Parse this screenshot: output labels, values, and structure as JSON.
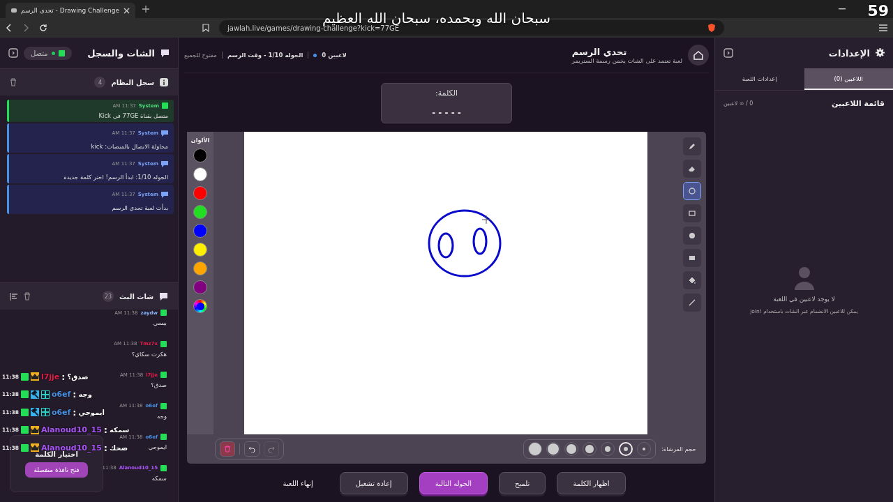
{
  "browser": {
    "tab_title": "تحدي الرسم - Drawing Challenge",
    "url": "jawlah.live/games/drawing-challenge?kick=77GE"
  },
  "overlay": {
    "caption": "سبحان الله وبحمده، سبحان الله العظيم",
    "counter": "59",
    "lines": [
      {
        "time": "11:38",
        "badges": [
          {
            "kind": "crown"
          }
        ],
        "user": "l7jje",
        "color": "#e11d48",
        "sep": ":",
        "text": "صدق؟"
      },
      {
        "time": "11:38",
        "badges": [
          {
            "kind": "hammer"
          },
          {
            "kind": "bot"
          }
        ],
        "user": "o6ef",
        "color": "#4a90e2",
        "sep": ":",
        "text": "وجه"
      },
      {
        "time": "11:38",
        "badges": [
          {
            "kind": "hammer"
          },
          {
            "kind": "bot"
          }
        ],
        "user": "o6ef",
        "color": "#4a90e2",
        "sep": ":",
        "text": "ايموجي"
      },
      {
        "time": "11:38",
        "badges": [
          {
            "kind": "crown"
          }
        ],
        "user": "Alanoud10_15",
        "color": "#a855f7",
        "sep": ":",
        "text": "سمكه"
      },
      {
        "time": "11:38",
        "badges": [
          {
            "kind": "crown"
          }
        ],
        "user": "Alanoud10_15",
        "color": "#a855f7",
        "sep": ":",
        "text": "ضحك"
      }
    ]
  },
  "chat_panel": {
    "title": "الشات والسجل",
    "status": "متصل",
    "connected": true,
    "system_log": {
      "title": "سجل النظام",
      "count": "4",
      "messages": [
        {
          "kind": "kick",
          "author": "System",
          "time": "11:37 AM",
          "text": "متصل بقناة 77GE في Kick"
        },
        {
          "kind": "system",
          "author": "System",
          "time": "11:37 AM",
          "text": "محاولة الاتصال بالمنصات: kick"
        },
        {
          "kind": "system",
          "author": "System",
          "time": "11:37 AM",
          "text": "الجوله 1/10: ابدأ الرسم! اختر كلمة جديدة"
        },
        {
          "kind": "system",
          "author": "System",
          "time": "11:37 AM",
          "text": "بدأت لعبة تحدي الرسم"
        }
      ]
    },
    "stream_chat": {
      "title": "شات البث",
      "count": "23",
      "messages": [
        {
          "author": "zaydw",
          "color": "#8ab4f8",
          "time": "11:38 AM",
          "text": "ببسي"
        },
        {
          "author": "Tmz7x",
          "color": "#e11d48",
          "time": "11:38 AM",
          "text": "هكرت سكاي؟"
        },
        {
          "author": "l7jje",
          "color": "#e11d48",
          "time": "11:38 AM",
          "text": "صدق؟"
        },
        {
          "author": "o6ef",
          "color": "#4a90e2",
          "time": "11:38 AM",
          "text": "وجه"
        },
        {
          "author": "o6ef",
          "color": "#4a90e2",
          "time": "11:38 AM",
          "text": "ايموجي"
        },
        {
          "author": "Alanoud10_15",
          "color": "#a855f7",
          "time": "11:38",
          "text": "سمكه"
        }
      ]
    },
    "word_picker": {
      "title": "اختيار الكلمة",
      "button": "فتح نافذة منفصلة"
    }
  },
  "game": {
    "title": "تحدي الرسم",
    "subtitle": "لعبة تعتمد على الشات يخمن رسمة الستريمر",
    "players": "0 لاعبين",
    "round": "الجوله 1/10 - وقت الرسم",
    "mode": "مفتوح للجميع",
    "word": {
      "label": "الكلمة:",
      "hint": "- - - - -"
    },
    "colors": {
      "title": "الألوان",
      "swatches": [
        {
          "kind": "solid",
          "color": "#000000"
        },
        {
          "kind": "solid",
          "color": "#ffffff"
        },
        {
          "kind": "solid",
          "color": "#ff0000"
        },
        {
          "kind": "solid",
          "color": "#22dd22"
        },
        {
          "kind": "solid",
          "color": "#0000ff"
        },
        {
          "kind": "solid",
          "color": "#ffee00"
        },
        {
          "kind": "solid",
          "color": "#ffa500"
        },
        {
          "kind": "solid",
          "color": "#800080"
        },
        {
          "kind": "custom",
          "color": "#0000ff"
        }
      ]
    },
    "tools": [
      {
        "kind": "pencil",
        "selected": false
      },
      {
        "kind": "eraser",
        "selected": false
      },
      {
        "kind": "circle",
        "selected": true
      },
      {
        "kind": "square",
        "selected": false
      },
      {
        "kind": "dot",
        "selected": false
      },
      {
        "kind": "rect",
        "selected": false
      },
      {
        "kind": "fill",
        "selected": false
      },
      {
        "kind": "line",
        "selected": false
      }
    ],
    "brush_label": "حجم الفرشاة:",
    "brush_sizes": [
      {
        "selected": false
      },
      {
        "selected": true
      },
      {
        "selected": false
      },
      {
        "selected": false
      },
      {
        "selected": false
      },
      {
        "selected": false
      },
      {
        "selected": false
      }
    ],
    "actions": [
      {
        "kind": "clear",
        "disabled": false
      },
      {
        "kind": "undo",
        "disabled": false
      },
      {
        "kind": "redo",
        "disabled": true
      }
    ],
    "buttons": [
      {
        "kind": "outline",
        "label": "اظهار الكلمة"
      },
      {
        "kind": "outline",
        "label": "تلميح"
      },
      {
        "kind": "primary",
        "label": "الجوله التالية"
      },
      {
        "kind": "outline",
        "label": "إعادة تشغيل"
      },
      {
        "kind": "text",
        "label": "إنهاء اللعبة"
      }
    ]
  },
  "settings": {
    "title": "الإعدادات",
    "tabs": [
      {
        "label": "اللاعبين (0)",
        "selected": true
      },
      {
        "label": "إعدادات اللعبة",
        "selected": false
      }
    ],
    "list_title": "قائمة اللاعبين",
    "list_count": "0 / ∞ لاعبين",
    "empty_title": "لا يوجد لاعبين في اللعبة",
    "empty_hint": "يمكن للاعبين الانضمام عبر الشات باستخدام !join"
  }
}
